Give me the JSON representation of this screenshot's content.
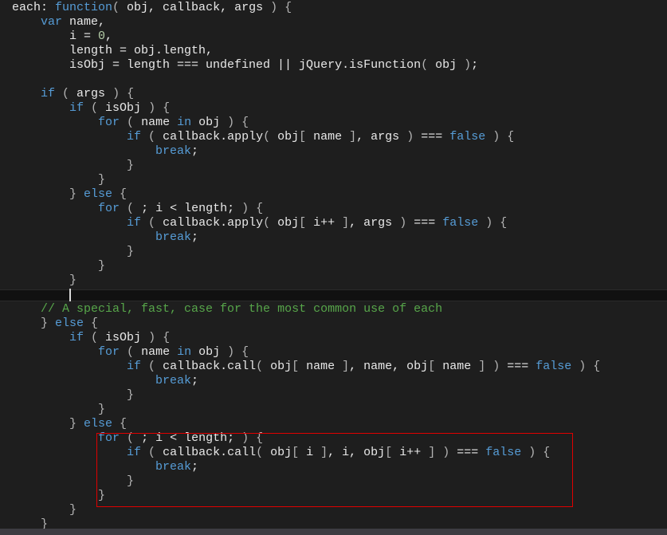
{
  "editor": {
    "language": "javascript",
    "colors": {
      "background": "#1e1e1e",
      "keyword": "#569cd6",
      "comment": "#57a64a",
      "number": "#b5cea8",
      "identifier": "#e8e8e8",
      "highlight_box": "#e00000"
    },
    "top_pane": {
      "lines": [
        [
          [
            "id",
            "each: "
          ],
          [
            "kw",
            "function"
          ],
          [
            "pn",
            "( "
          ],
          [
            "id",
            "obj, callback, args "
          ],
          [
            "pn",
            ") {"
          ]
        ],
        [
          [
            "id",
            "    "
          ],
          [
            "kw",
            "var"
          ],
          [
            "id",
            " name,"
          ]
        ],
        [
          [
            "id",
            "        i = "
          ],
          [
            "num",
            "0"
          ],
          [
            "id",
            ","
          ]
        ],
        [
          [
            "id",
            "        length = obj.length,"
          ]
        ],
        [
          [
            "id",
            "        isObj = length === undefined || jQuery.isFunction"
          ],
          [
            "pn",
            "( "
          ],
          [
            "id",
            "obj "
          ],
          [
            "pn",
            ")"
          ],
          [
            "id",
            ";"
          ]
        ],
        [
          [
            "id",
            ""
          ]
        ],
        [
          [
            "id",
            "    "
          ],
          [
            "kw",
            "if"
          ],
          [
            "pn",
            " ( "
          ],
          [
            "id",
            "args "
          ],
          [
            "pn",
            ") {"
          ]
        ],
        [
          [
            "id",
            "        "
          ],
          [
            "kw",
            "if"
          ],
          [
            "pn",
            " ( "
          ],
          [
            "id",
            "isObj "
          ],
          [
            "pn",
            ") {"
          ]
        ],
        [
          [
            "id",
            "            "
          ],
          [
            "kw",
            "for"
          ],
          [
            "pn",
            " ( "
          ],
          [
            "id",
            "name "
          ],
          [
            "kw",
            "in"
          ],
          [
            "id",
            " obj "
          ],
          [
            "pn",
            ") {"
          ]
        ],
        [
          [
            "id",
            "                "
          ],
          [
            "kw",
            "if"
          ],
          [
            "pn",
            " ( "
          ],
          [
            "id",
            "callback.apply"
          ],
          [
            "pn",
            "( "
          ],
          [
            "id",
            "obj"
          ],
          [
            "pn",
            "[ "
          ],
          [
            "id",
            "name "
          ],
          [
            "pn",
            "]"
          ],
          [
            "id",
            ", args "
          ],
          [
            "pn",
            ")"
          ],
          [
            "id",
            " === "
          ],
          [
            "kw",
            "false"
          ],
          [
            "pn",
            " ) {"
          ]
        ],
        [
          [
            "id",
            "                    "
          ],
          [
            "kw",
            "break"
          ],
          [
            "id",
            ";"
          ]
        ],
        [
          [
            "pn",
            "                }"
          ]
        ],
        [
          [
            "pn",
            "            }"
          ]
        ],
        [
          [
            "pn",
            "        } "
          ],
          [
            "kw",
            "else"
          ],
          [
            "pn",
            " {"
          ]
        ],
        [
          [
            "id",
            "            "
          ],
          [
            "kw",
            "for"
          ],
          [
            "pn",
            " ( "
          ],
          [
            "id",
            "; i < length; "
          ],
          [
            "pn",
            ") {"
          ]
        ],
        [
          [
            "id",
            "                "
          ],
          [
            "kw",
            "if"
          ],
          [
            "pn",
            " ( "
          ],
          [
            "id",
            "callback.apply"
          ],
          [
            "pn",
            "( "
          ],
          [
            "id",
            "obj"
          ],
          [
            "pn",
            "[ "
          ],
          [
            "id",
            "i++ "
          ],
          [
            "pn",
            "]"
          ],
          [
            "id",
            ", args "
          ],
          [
            "pn",
            ")"
          ],
          [
            "id",
            " === "
          ],
          [
            "kw",
            "false"
          ],
          [
            "pn",
            " ) {"
          ]
        ],
        [
          [
            "id",
            "                    "
          ],
          [
            "kw",
            "break"
          ],
          [
            "id",
            ";"
          ]
        ],
        [
          [
            "pn",
            "                }"
          ]
        ],
        [
          [
            "pn",
            "            }"
          ]
        ],
        [
          [
            "pn",
            "        }"
          ]
        ]
      ]
    },
    "bottom_pane": {
      "lines": [
        [
          [
            "id",
            "    "
          ],
          [
            "cm",
            "// A special, fast, case for the most common use of each"
          ]
        ],
        [
          [
            "pn",
            "    } "
          ],
          [
            "kw",
            "else"
          ],
          [
            "pn",
            " {"
          ]
        ],
        [
          [
            "id",
            "        "
          ],
          [
            "kw",
            "if"
          ],
          [
            "pn",
            " ( "
          ],
          [
            "id",
            "isObj "
          ],
          [
            "pn",
            ") {"
          ]
        ],
        [
          [
            "id",
            "            "
          ],
          [
            "kw",
            "for"
          ],
          [
            "pn",
            " ( "
          ],
          [
            "id",
            "name "
          ],
          [
            "kw",
            "in"
          ],
          [
            "id",
            " obj "
          ],
          [
            "pn",
            ") {"
          ]
        ],
        [
          [
            "id",
            "                "
          ],
          [
            "kw",
            "if"
          ],
          [
            "pn",
            " ( "
          ],
          [
            "id",
            "callback.call"
          ],
          [
            "pn",
            "( "
          ],
          [
            "id",
            "obj"
          ],
          [
            "pn",
            "[ "
          ],
          [
            "id",
            "name "
          ],
          [
            "pn",
            "]"
          ],
          [
            "id",
            ", name, obj"
          ],
          [
            "pn",
            "[ "
          ],
          [
            "id",
            "name "
          ],
          [
            "pn",
            "] )"
          ],
          [
            "id",
            " === "
          ],
          [
            "kw",
            "false"
          ],
          [
            "pn",
            " ) {"
          ]
        ],
        [
          [
            "id",
            "                    "
          ],
          [
            "kw",
            "break"
          ],
          [
            "id",
            ";"
          ]
        ],
        [
          [
            "pn",
            "                }"
          ]
        ],
        [
          [
            "pn",
            "            }"
          ]
        ],
        [
          [
            "pn",
            "        } "
          ],
          [
            "kw",
            "else"
          ],
          [
            "pn",
            " {"
          ]
        ],
        [
          [
            "id",
            "            "
          ],
          [
            "kw",
            "for"
          ],
          [
            "pn",
            " ( "
          ],
          [
            "id",
            "; i < length; "
          ],
          [
            "pn",
            ") {"
          ]
        ],
        [
          [
            "id",
            "                "
          ],
          [
            "kw",
            "if"
          ],
          [
            "pn",
            " ( "
          ],
          [
            "id",
            "callback.call"
          ],
          [
            "pn",
            "( "
          ],
          [
            "id",
            "obj"
          ],
          [
            "pn",
            "[ "
          ],
          [
            "id",
            "i "
          ],
          [
            "pn",
            "]"
          ],
          [
            "id",
            ", i, obj"
          ],
          [
            "pn",
            "[ "
          ],
          [
            "id",
            "i++ "
          ],
          [
            "pn",
            "] )"
          ],
          [
            "id",
            " === "
          ],
          [
            "kw",
            "false"
          ],
          [
            "pn",
            " ) {"
          ]
        ],
        [
          [
            "id",
            "                    "
          ],
          [
            "kw",
            "break"
          ],
          [
            "id",
            ";"
          ]
        ],
        [
          [
            "pn",
            "                }"
          ]
        ],
        [
          [
            "pn",
            "            }"
          ]
        ],
        [
          [
            "pn",
            "        }"
          ]
        ],
        [
          [
            "pn",
            "    }"
          ]
        ]
      ]
    },
    "highlight": {
      "label": "highlighted-for-loop",
      "pane": "bottom",
      "from_line": 9,
      "to_line": 13
    }
  }
}
